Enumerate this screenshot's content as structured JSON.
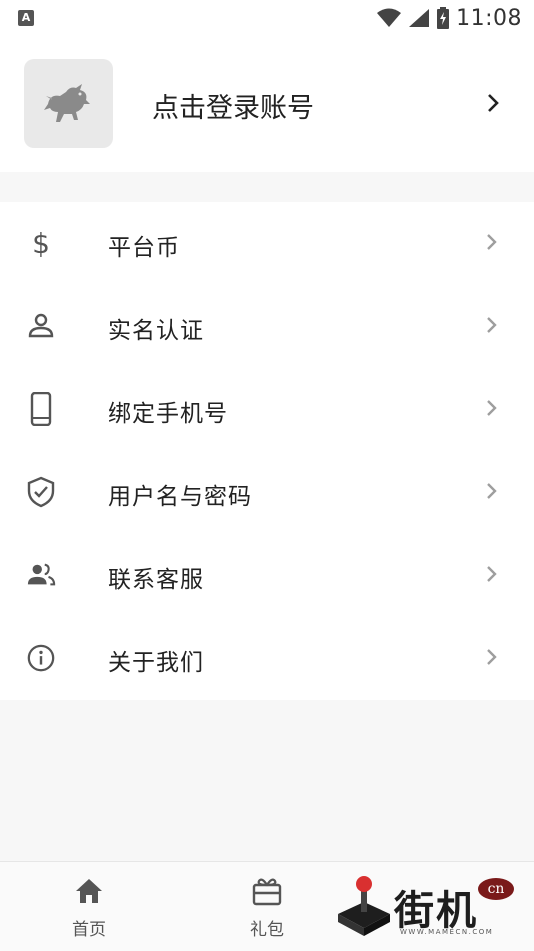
{
  "status_bar": {
    "time": "11:08",
    "app_badge": "A"
  },
  "profile": {
    "login_label": "点击登录账号"
  },
  "menu": {
    "items": [
      {
        "label": "平台币",
        "icon": "dollar-icon"
      },
      {
        "label": "实名认证",
        "icon": "person-icon"
      },
      {
        "label": "绑定手机号",
        "icon": "phone-icon"
      },
      {
        "label": "用户名与密码",
        "icon": "shield-check-icon"
      },
      {
        "label": "联系客服",
        "icon": "people-icon"
      },
      {
        "label": "关于我们",
        "icon": "info-icon"
      }
    ]
  },
  "bottom_nav": {
    "tabs": [
      {
        "label": "首页",
        "icon": "home-icon"
      },
      {
        "label": "礼包",
        "icon": "gift-icon"
      }
    ]
  },
  "watermark": {
    "text": "街机",
    "badge": "cn",
    "url": "WWW.MAMECN.COM"
  },
  "colors": {
    "icon": "#555555",
    "chevron": "#9e9e9e",
    "background": "#f7f7f7"
  }
}
